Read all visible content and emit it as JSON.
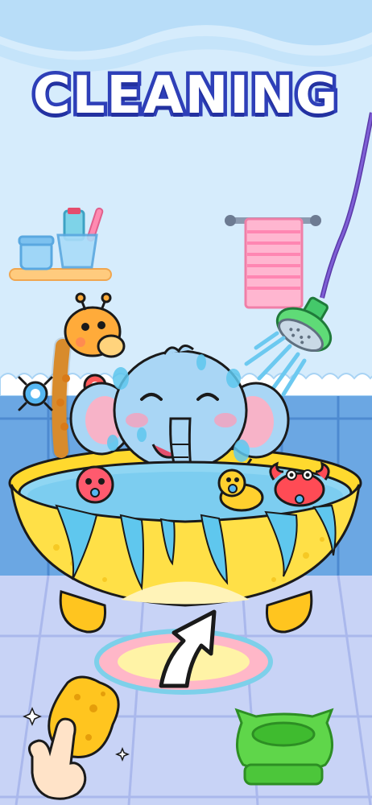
{
  "title": "CLEANING",
  "colors": {
    "title_outline": "#2e3fb8",
    "wall": "#cfe9fb",
    "tiles": "#6fa8e6",
    "floor": "#c9d5f7",
    "tub": "#ffe047",
    "water": "#5fc7ee",
    "elephant": "#a9d6f5",
    "sponge": "#ffc51f",
    "towel": "#ffb3cf",
    "potty": "#5fd64a"
  },
  "objects": [
    "shower-head",
    "elephant",
    "bathtub",
    "rubber-duck",
    "octopus-toy",
    "crab-toy",
    "giraffe-faucet",
    "towel",
    "shelf",
    "toothbrush-cup",
    "sponge",
    "bath-mat",
    "potty",
    "arrow-hint",
    "hand-pointer"
  ]
}
